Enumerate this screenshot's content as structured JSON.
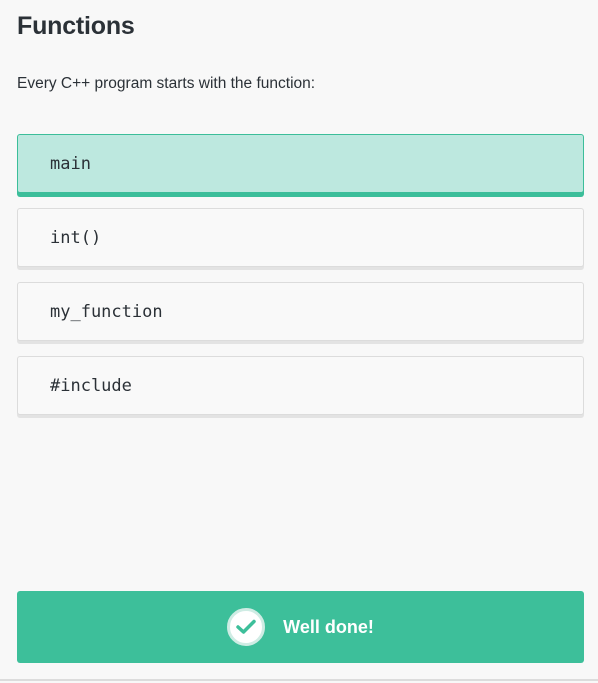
{
  "lesson": {
    "title": "Functions",
    "question": "Every C++ program starts with the function:"
  },
  "options": [
    {
      "label": "main",
      "state": "selected-correct"
    },
    {
      "label": "int()",
      "state": "default"
    },
    {
      "label": "my_function",
      "state": "default"
    },
    {
      "label": "#include",
      "state": "default"
    }
  ],
  "feedback": {
    "text": "Well done!",
    "icon": "check-icon"
  },
  "colors": {
    "accent": "#3dbf9a",
    "selected_bg": "#bde8df",
    "text": "#2b3137",
    "background": "#f8f8f8"
  }
}
